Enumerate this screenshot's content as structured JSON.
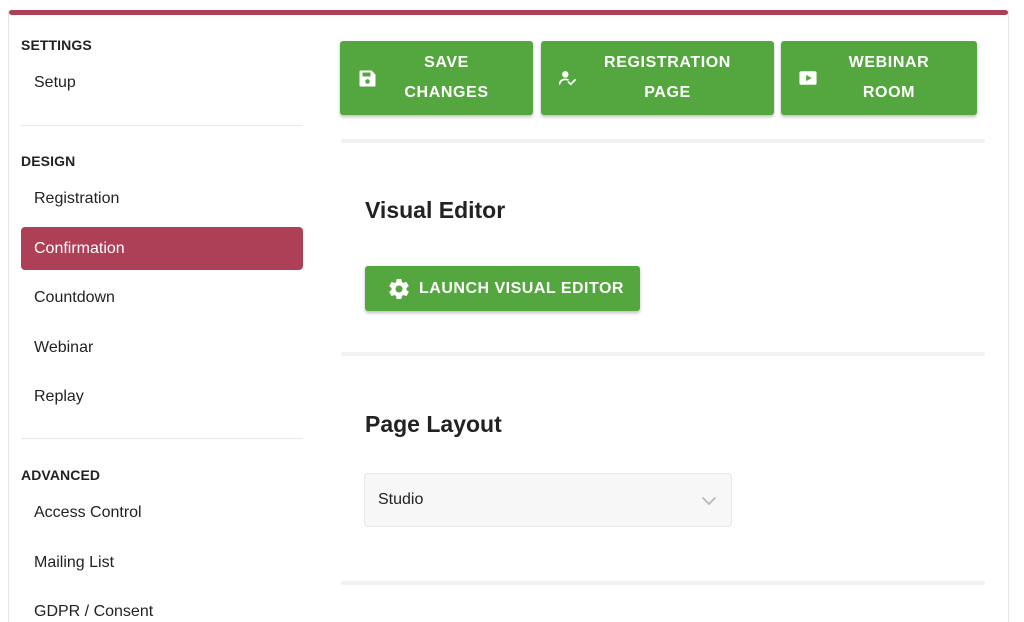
{
  "sidebar": {
    "sections": [
      {
        "title": "SETTINGS",
        "items": [
          "Setup"
        ]
      },
      {
        "title": "DESIGN",
        "items": [
          "Registration",
          "Confirmation",
          "Countdown",
          "Webinar",
          "Replay"
        ]
      },
      {
        "title": "ADVANCED",
        "items": [
          "Access Control",
          "Mailing List",
          "GDPR / Consent"
        ]
      }
    ],
    "active_item": "Confirmation"
  },
  "toolbar": {
    "save": {
      "line1": "SAVE",
      "line2": "CHANGES",
      "icon": "floppy-disk-icon"
    },
    "registration": {
      "line1": "REGISTRATION",
      "line2": "PAGE",
      "icon": "user-check-icon"
    },
    "webinar": {
      "line1": "WEBINAR",
      "line2": "ROOM",
      "icon": "play-icon"
    }
  },
  "visual_editor": {
    "heading": "Visual Editor",
    "button_label": "LAUNCH VISUAL EDITOR",
    "icon": "gear-icon"
  },
  "page_layout": {
    "heading": "Page Layout",
    "selected": "Studio"
  },
  "colors": {
    "accent": "#ad3f57",
    "button_green": "#54a73f"
  }
}
